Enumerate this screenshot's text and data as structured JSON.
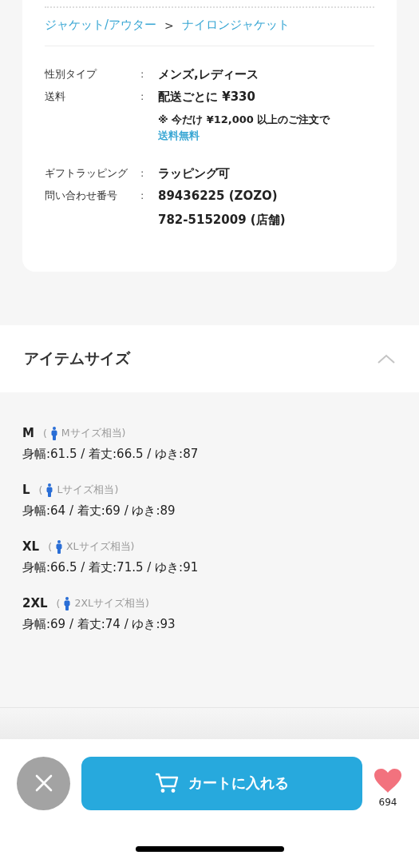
{
  "breadcrumb": {
    "items": [
      "ジャケット/アウター",
      "ナイロンジャケット"
    ],
    "separator": ">"
  },
  "details": [
    {
      "label": "性別タイプ",
      "lines": [
        "メンズ,レディース"
      ]
    },
    {
      "label": "送料",
      "lines": [
        "配送ごとに ¥330"
      ],
      "note": {
        "text": "※ 今だけ ¥12,000 以上のご注文で",
        "link": "送料無料"
      }
    },
    {
      "label": "ギフトラッピング",
      "lines": [
        "ラッピング可"
      ]
    },
    {
      "label": "問い合わせ番号",
      "lines": [
        "89436225 (ZOZO)",
        "782-5152009 (店舗)"
      ]
    }
  ],
  "detail_colon": ":",
  "size_section": {
    "title": "アイテムサイズ",
    "expanded": true,
    "sizes": [
      {
        "name": "M",
        "open_bracket": "(",
        "equivalent": "Mサイズ相当)",
        "measurements": "身幅:61.5 / 着丈:66.5 / ゆき:87"
      },
      {
        "name": "L",
        "open_bracket": "(",
        "equivalent": "Lサイズ相当)",
        "measurements": "身幅:64 / 着丈:69 / ゆき:89"
      },
      {
        "name": "XL",
        "open_bracket": "(",
        "equivalent": "XLサイズ相当)",
        "measurements": "身幅:66.5 / 着丈:71.5 / ゆき:91"
      },
      {
        "name": "2XL",
        "open_bracket": "(",
        "equivalent": "2XLサイズ相当)",
        "measurements": "身幅:69 / 着丈:74 / ゆき:93"
      }
    ]
  },
  "footer": {
    "cart_button": "カートに入れる",
    "favorite_count": "694"
  }
}
